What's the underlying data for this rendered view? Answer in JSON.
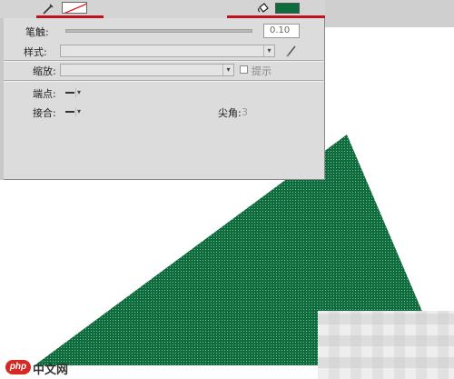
{
  "toolbar": {
    "stroke_tool_icon": "pencil-icon",
    "fill_tool_icon": "paint-bucket-icon",
    "stroke_color": "none",
    "fill_color": "#0d6b3c",
    "highlight_color": "#c0111f"
  },
  "properties": {
    "stroke_label": "笔触:",
    "stroke_value": "0.10",
    "style_label": "样式:",
    "style_value": "",
    "scale_label": "缩放:",
    "scale_value": "",
    "hint_label": "提示",
    "hint_checked": false,
    "cap_label": "端点:",
    "join_label": "接合:",
    "miter_label": "尖角:",
    "miter_value": "3"
  },
  "canvas": {
    "shape": "triangle",
    "shape_fill": "#0d6b3c",
    "background": "#ffffff"
  },
  "watermark": {
    "logo": "php",
    "text": "中文网"
  }
}
